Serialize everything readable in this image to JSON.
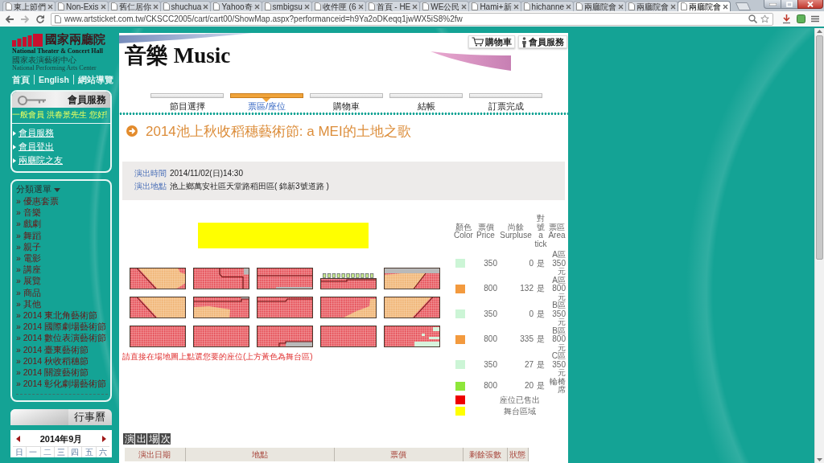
{
  "browser": {
    "tabs": [
      {
        "title": "東上節們",
        "selected": false
      },
      {
        "title": "Non-Exis",
        "selected": false
      },
      {
        "title": "舊仁居你",
        "selected": false
      },
      {
        "title": "shuchua",
        "selected": false
      },
      {
        "title": "Yahoo奇",
        "selected": false
      },
      {
        "title": "smbigsu",
        "selected": false
      },
      {
        "title": "收件匣 (6",
        "selected": false
      },
      {
        "title": "首頁 - HE",
        "selected": false
      },
      {
        "title": "WE公民",
        "selected": false
      },
      {
        "title": "Hami+新",
        "selected": false
      },
      {
        "title": "hichanne",
        "selected": false
      },
      {
        "title": "兩廳院會",
        "selected": false
      },
      {
        "title": "兩廳院會",
        "selected": false
      },
      {
        "title": "兩廳院會",
        "selected": true
      }
    ],
    "url": "www.artsticket.com.tw/CKSCC2005/cart/cart00/ShowMap.aspx?performanceid=h9Ya2oDKeqq1jwWX5iS8%2fw"
  },
  "sidebar": {
    "logo": {
      "name": "國家兩廳院",
      "english": "National Theater & Concert Hall",
      "org_zh": "國家表演藝術中心",
      "org_en": "National Performing Arts Center"
    },
    "top_links": [
      "首頁",
      "English",
      "網站導覽"
    ],
    "member": {
      "title": "會員服務",
      "greeting": "一般會員 洪春景先生 您好!",
      "links": [
        "會員服務",
        "會員登出",
        "兩廳院之友"
      ]
    },
    "categories": {
      "title": "分類選單",
      "items": [
        "» 優惠套票",
        "» 音樂",
        "» 戲劇",
        "» 舞蹈",
        "» 親子",
        "» 電影",
        "» 講座",
        "» 展覽",
        "» 商品",
        "» 其他",
        "» 2014 東北角藝術節",
        "» 2014 國際劇場藝術節",
        "» 2014 數位表演藝術節",
        "» 2014 臺東藝術節",
        "» 2014 秋收稻穗節",
        "» 2014 關渡藝術節",
        "» 2014 彰化劇場藝術節"
      ]
    },
    "calendar": {
      "title": "行事曆",
      "month": "2014年9月",
      "weekdays": [
        "日",
        "一",
        "二",
        "三",
        "四",
        "五",
        "六"
      ]
    }
  },
  "header": {
    "section": "音樂 Music",
    "buttons": [
      {
        "kind": "cart",
        "label": "購物車"
      },
      {
        "kind": "member",
        "label": "會員服務"
      }
    ]
  },
  "steps": [
    {
      "label": "節目選擇",
      "selected": false
    },
    {
      "label": "票區/座位",
      "selected": true
    },
    {
      "label": "購物車",
      "selected": false
    },
    {
      "label": "結帳",
      "selected": false
    },
    {
      "label": "訂票完成",
      "selected": false
    }
  ],
  "event": {
    "title": "2014池上秋收稻穗藝術節: a MEI的土地之歌",
    "details": [
      {
        "label": "演出時間",
        "value": "2014/11/02(日)14:30"
      },
      {
        "label": "演出地點",
        "value": "池上鄉萬安社區天堂路稻田區( 錦新3號道路 )"
      }
    ]
  },
  "seat_map": {
    "note": "請直接在場地圖上點選您要的座位(上方黃色為舞台區)"
  },
  "legend": {
    "columns": [
      "顏色 Color",
      "票價 Price",
      "尚餘 Surpluse",
      "對號 a tick",
      "票區 Area"
    ],
    "rows": [
      {
        "kind": "price",
        "color": "#ccf5d6",
        "price": "350",
        "remaining": "0",
        "numbered": "是",
        "area": "A區350元"
      },
      {
        "kind": "price",
        "color": "#f39a3e",
        "price": "800",
        "remaining": "132",
        "numbered": "是",
        "area": "A區800元"
      },
      {
        "kind": "price",
        "color": "#ccf5d6",
        "price": "350",
        "remaining": "0",
        "numbered": "是",
        "area": "B區350元"
      },
      {
        "kind": "price",
        "color": "#f39a3e",
        "price": "800",
        "remaining": "335",
        "numbered": "是",
        "area": "B區800元"
      },
      {
        "kind": "price",
        "color": "#ccf5d6",
        "price": "350",
        "remaining": "27",
        "numbered": "是",
        "area": "C區350元"
      },
      {
        "kind": "price",
        "color": "#8ee63a",
        "price": "800",
        "remaining": "20",
        "numbered": "是",
        "area": "輪椅席"
      },
      {
        "kind": "note",
        "color": "#ee0000",
        "note": "座位已售出"
      },
      {
        "kind": "note",
        "color": "#ffff00",
        "note": "舞台區域"
      }
    ]
  },
  "sessions": {
    "title": "演出場次",
    "columns": [
      "演出日期",
      "地點",
      "票價",
      "剩餘張數",
      "狀態"
    ]
  }
}
